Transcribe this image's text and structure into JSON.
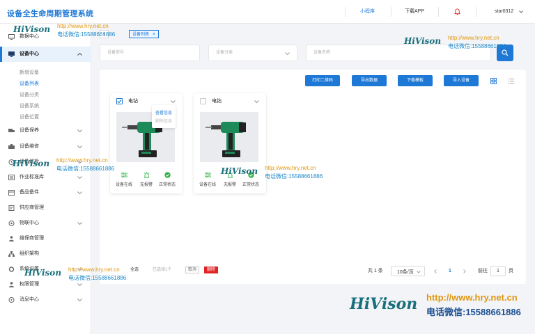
{
  "app": {
    "title": "设备全生命周期管理系统"
  },
  "topbar": {
    "nav": [
      "小程序",
      "下载APP"
    ],
    "active_nav": "小程序",
    "user": "star0312"
  },
  "sidebar": {
    "items": [
      {
        "label": "数据中心"
      },
      {
        "label": "设备中心",
        "expanded": true,
        "children": [
          "新增设备",
          "设备列表",
          "设备分类",
          "设备系统",
          "设备位置"
        ],
        "active_child": "设备列表"
      },
      {
        "label": "设备保养"
      },
      {
        "label": "设备维修"
      },
      {
        "label": "设备巡检"
      },
      {
        "label": "作业标准库"
      },
      {
        "label": "备品备件"
      },
      {
        "label": "供应商管理"
      },
      {
        "label": "物联中心"
      },
      {
        "label": "维保商管理"
      },
      {
        "label": "组织架构"
      },
      {
        "label": "系统设置"
      },
      {
        "label": "权限管理"
      },
      {
        "label": "消息中心"
      }
    ]
  },
  "tabs": {
    "home_tag": "o",
    "active_tag": "设备列表"
  },
  "filters": {
    "model_placeholder": "设备型号",
    "category_placeholder": "设备分类",
    "name_placeholder": "设备名称"
  },
  "toolbar": {
    "print_qr": "打印二维码",
    "export": "导出数据",
    "download_template": "下载模板",
    "import": "导入设备"
  },
  "cards": [
    {
      "name": "电钻",
      "checked": true,
      "statuses": [
        "设备在线",
        "无报警",
        "正常状态"
      ],
      "menu": [
        "查看信息",
        "删除信息"
      ]
    },
    {
      "name": "电钻",
      "checked": false,
      "statuses": [
        "设备在线",
        "无报警",
        "正常状态"
      ]
    }
  ],
  "bulk": {
    "select_all": "全选",
    "selected_count": "已选择1个",
    "cancel": "取消",
    "delete": "删除"
  },
  "pagination": {
    "total": "共 1 条",
    "page_size": "10条/页",
    "current_page": "1",
    "goto_label": "前往",
    "goto_value": "1",
    "page_suffix": "页"
  },
  "watermark": {
    "logo": "HiVison",
    "url": "http://www.hry.net.cn",
    "tel": "电话微信:15588661886"
  },
  "colors": {
    "primary": "#1e78d6",
    "danger": "#e02424",
    "success": "#36b24a",
    "warning": "#f0a020",
    "watermark_logo": "#1a6f7c",
    "watermark_url": "#e0960f"
  }
}
